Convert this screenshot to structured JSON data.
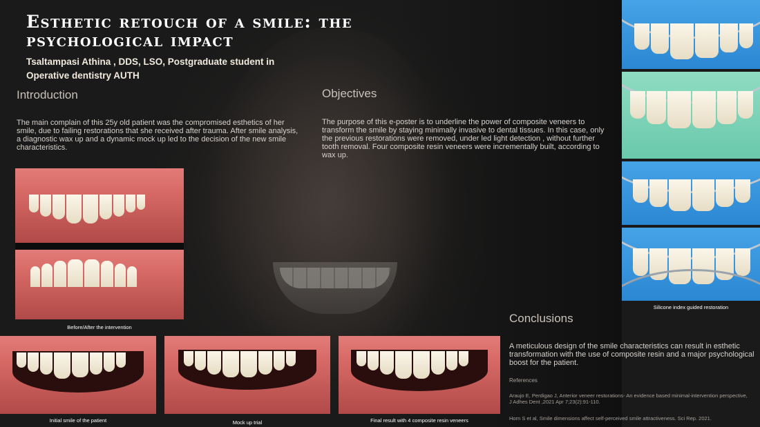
{
  "poster": {
    "title": "Esthetic retouch of a smile: the psychological impact",
    "author": "Tsaltampasi Athina , DDS, LSO, Postgraduate student in Operative dentistry AUTH"
  },
  "introduction": {
    "heading": "Introduction",
    "text": "The main complain of this 25y old patient was the compromised esthetics of her smile, due to failing restorations that she received after trauma. After smile analysis, a diagnostic wax up and a dynamic mock up led to the decision of the new smile characteristics."
  },
  "objectives": {
    "heading": "Objectives",
    "text": "The purpose of this e-poster is to underline the power of composite veneers to transform the smile by staying minimally invasive to dental tissues. In this case, only the previous restorations were removed, under led light detection , without further tooth removal. Four composite resin veneers were incrementally built, according to wax up."
  },
  "conclusions": {
    "heading": "Conclusions",
    "text": "A meticulous design of the smile characteristics can result in esthetic transformation with the use of composite resin and a major psychological boost for the patient."
  },
  "references": {
    "heading": "References",
    "items": [
      "Araujo E, Perdigao J, Anterior veneer restorations- An evidence based minimal-intervention perspective, J Adhes Dent ,2021 Apr 7;23(2):91-110.",
      "Horn S et al, Smile dimensions affect self-perceived smile attractiveness. Sci Rep. 2021."
    ]
  },
  "captions": {
    "before_after": "Before/After the intervention",
    "silicone": "Silicone index guided restoration",
    "initial": "Initial smile of the patient",
    "mockup": "Mock up trial",
    "final": "Final result with 4 composite resin veneers"
  },
  "colors": {
    "background": "#1b1b1b",
    "title": "#ffffff",
    "heading": "#c9c2bb",
    "body_text": "#d7d2cd",
    "gum": "#d86a66",
    "rubber_dam": "#2b87d2"
  }
}
